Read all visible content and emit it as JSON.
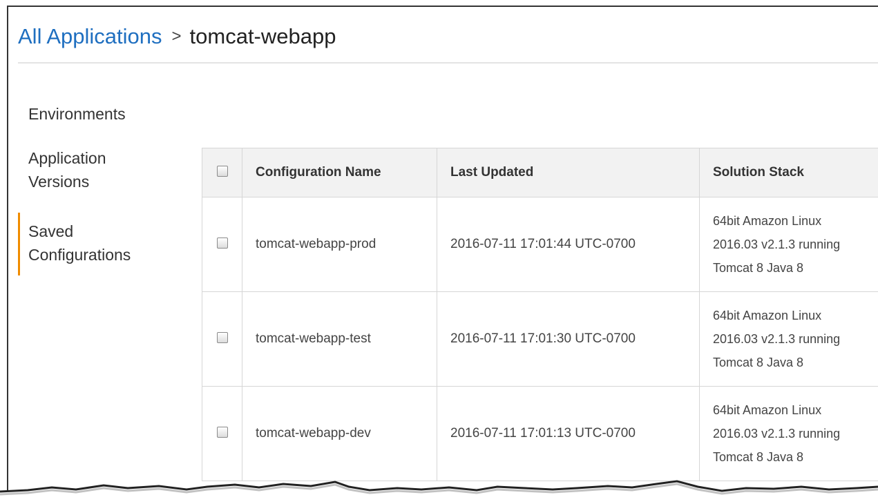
{
  "breadcrumb": {
    "parent_label": "All Applications",
    "separator": ">",
    "current_label": "tomcat-webapp"
  },
  "sidebar": {
    "items": [
      {
        "label": "Environments",
        "active": false
      },
      {
        "label": "Application Versions",
        "lines": [
          "Application",
          "Versions"
        ],
        "active": false
      },
      {
        "label": "Saved Configurations",
        "lines": [
          "Saved",
          "Configurations"
        ],
        "active": true
      }
    ],
    "accent_color": "#f08c00"
  },
  "table": {
    "headers": [
      "Configuration Name",
      "Last Updated",
      "Solution Stack"
    ],
    "rows": [
      {
        "name": "tomcat-webapp-prod",
        "updated": "2016-07-11 17:01:44 UTC-0700",
        "stack_lines": [
          "64bit Amazon Linux",
          "2016.03 v2.1.3 running",
          "Tomcat 8 Java 8"
        ]
      },
      {
        "name": "tomcat-webapp-test",
        "updated": "2016-07-11 17:01:30 UTC-0700",
        "stack_lines": [
          "64bit Amazon Linux",
          "2016.03 v2.1.3 running",
          "Tomcat 8 Java 8"
        ]
      },
      {
        "name": "tomcat-webapp-dev",
        "updated": "2016-07-11 17:01:13 UTC-0700",
        "stack_lines": [
          "64bit Amazon Linux",
          "2016.03 v2.1.3 running",
          "Tomcat 8 Java 8"
        ]
      }
    ]
  },
  "colors": {
    "link": "#1f6fc0",
    "header_bg": "#f2f2f2",
    "border": "#d6d6d6"
  }
}
